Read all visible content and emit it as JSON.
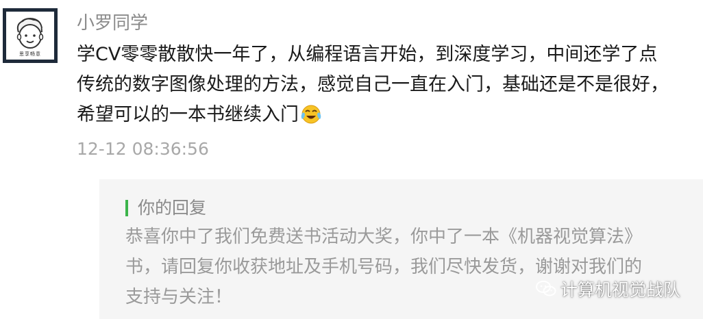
{
  "comment": {
    "avatar_caption": "思享畅意",
    "username": "小罗同学",
    "text_line1": "学CV零零散散快一年了，从编程语言开始，到深度学习，中间还学了点",
    "text_line2": "传统的数字图像处理的方法，感觉自己一直在入门，基础还是不是很好，",
    "text_line3": "希望可以的一本书继续入门",
    "emoji_icon": "laughing-crying-emoji",
    "timestamp": "12-12 08:36:56"
  },
  "reply": {
    "title": "你的回复",
    "text_line1": "恭喜你中了我们免费送书活动大奖，你中了一本《机器视觉算法》",
    "text_line2": "书，请回复你收获地址及手机号码，我们尽快发货，谢谢对我们的",
    "text_line3": "支持与关注！",
    "accent_color": "#3cb44b"
  },
  "watermark": {
    "icon": "wechat-icon",
    "text": "计算机视觉战队"
  }
}
